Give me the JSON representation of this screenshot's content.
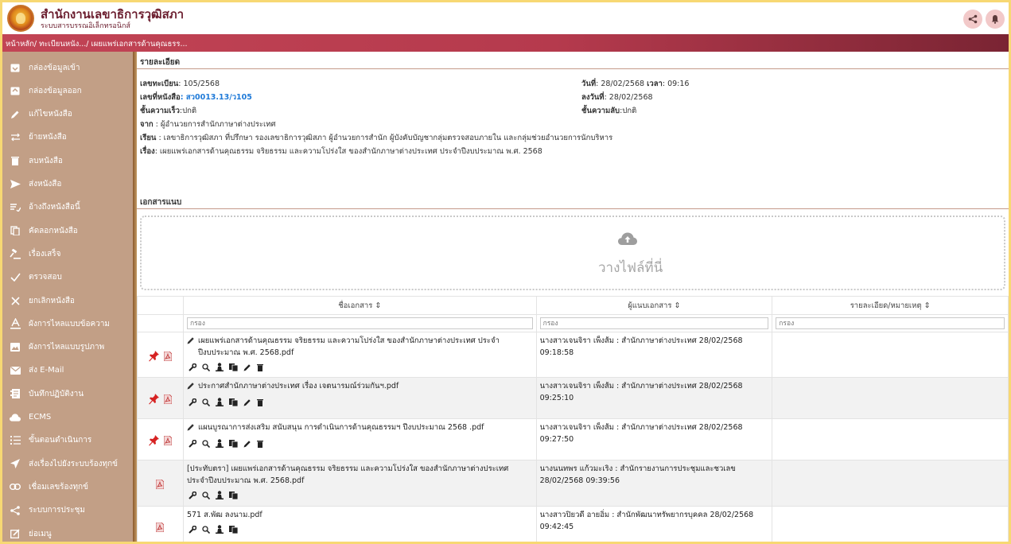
{
  "header": {
    "org_title": "สำนักงานเลขาธิการวุฒิสภา",
    "org_subtitle": "ระบบสารบรรณอิเล็กทรอนิกส์"
  },
  "breadcrumb": "หน้าหลัก/ ทะเบียนหนัง.../ เผยแพร่เอกสารด้านคุณธรร...",
  "sidebar": {
    "items": [
      {
        "label": "กล่องข้อมูลเข้า",
        "icon": "inbox-icon"
      },
      {
        "label": "กล่องข้อมูลออก",
        "icon": "outbox-icon"
      },
      {
        "label": "แก้ไขหนังสือ",
        "icon": "pencil-icon"
      },
      {
        "label": "ย้ายหนังสือ",
        "icon": "swap-icon"
      },
      {
        "label": "ลบหนังสือ",
        "icon": "trash-icon"
      },
      {
        "label": "ส่งหนังสือ",
        "icon": "send-icon"
      },
      {
        "label": "อ้างถึงหนังสือนี้",
        "icon": "reference-icon"
      },
      {
        "label": "คัดลอกหนังสือ",
        "icon": "copy-icon"
      },
      {
        "label": "เรื่องเสร็จ",
        "icon": "gavel-icon"
      },
      {
        "label": "ตรวจสอบ",
        "icon": "check-icon"
      },
      {
        "label": "ยกเลิกหนังสือ",
        "icon": "x-icon"
      },
      {
        "label": "ผังการไหลแบบข้อความ",
        "icon": "text-flow-icon"
      },
      {
        "label": "ผังการไหลแบบรูปภาพ",
        "icon": "image-flow-icon"
      },
      {
        "label": "ส่ง E-Mail",
        "icon": "mail-icon"
      },
      {
        "label": "บันทึกปฏิบัติงาน",
        "icon": "journal-icon"
      },
      {
        "label": "ECMS",
        "icon": "cloud-icon"
      },
      {
        "label": "ขั้นตอนดำเนินการ",
        "icon": "steps-icon"
      },
      {
        "label": "ส่งเรื่องไปยังระบบร้องทุกข์",
        "icon": "arrow-send-icon"
      },
      {
        "label": "เชื่อมเลขร้องทุกข์",
        "icon": "link-icon"
      },
      {
        "label": "ระบบการประชุม",
        "icon": "meeting-share-icon"
      },
      {
        "label": "ย่อเมนู",
        "icon": "collapse-icon"
      }
    ]
  },
  "details": {
    "section_title": "รายละเอียด",
    "reg_no_label": "เลขทะเบียน",
    "reg_no": ": 105/2568",
    "doc_no_label": "เลขที่หนังสือ",
    "doc_no": ": สว0013.13/ว105",
    "urgency_label": "ชั้นความเร็ว",
    "urgency": ":ปกติ",
    "from_label": "จาก",
    "from": " : ผู้อำนวยการสำนักภาษาต่างประเทศ",
    "to_label": "เรียน",
    "to": " : เลขาธิการวุฒิสภา ที่ปรึกษา รองเลขาธิการวุฒิสภา ผู้อำนวยการสำนัก ผู้บังคับบัญชากลุ่มตรวจสอบภายใน และกลุ่มช่วยอำนวยการนักบริหาร",
    "subject_label": "เรื่อง",
    "subject": ": เผยแพร่เอกสารด้านคุณธรรม จริยธรรม และความโปร่งใส ของสำนักภาษาต่างประเทศ ประจำปีงบประมาณ พ.ศ. 2568",
    "date_label": "วันที่",
    "date": ": 28/02/2568",
    "time_label": "เวลา",
    "time": ": 09:16",
    "sign_date_label": "ลงวันที่",
    "sign_date": ": 28/02/2568",
    "secrecy_label": "ชั้นความลับ",
    "secrecy": ":ปกติ"
  },
  "attachments": {
    "section_title": "เอกสารแนบ",
    "dropzone_text": "วางไฟล์ที่นี่",
    "columns": [
      "ชื่อเอกสาร ⇕",
      "ผู้แนบเอกสาร ⇕",
      "รายละเอียด/หมายเหตุ ⇕"
    ],
    "filter_placeholder": "กรอง",
    "rows": [
      {
        "name": "เผยแพร่เอกสารด้านคุณธรรม จริยธรรม และความโปร่งใส ของสำนักภาษาต่างประเทศ ประจำปีงบประมาณ พ.ศ. 2568.pdf",
        "uploader": "นางสาวเจนจิรา เพ็งส้ม : สำนักภาษาต่างประเทศ 28/02/2568 09:18:58",
        "pinned": true,
        "editable": true
      },
      {
        "name": "ประกาศสำนักภาษาต่างประเทศ เรื่อง เจตนารมณ์ร่วมกันฯ.pdf",
        "uploader": "นางสาวเจนจิรา เพ็งส้ม : สำนักภาษาต่างประเทศ 28/02/2568 09:25:10",
        "pinned": true,
        "editable": true
      },
      {
        "name": "แผนบูรณาการส่งเสริม สนับสนุน การดำเนินการด้านคุณธรรมฯ ปีงบประมาณ 2568 .pdf",
        "uploader": "นางสาวเจนจิรา เพ็งส้ม : สำนักภาษาต่างประเทศ 28/02/2568 09:27:50",
        "pinned": true,
        "editable": true
      },
      {
        "name": "[ประทับตรา] เผยแพร่เอกสารด้านคุณธรรม จริยธรรม และความโปร่งใส ของสำนักภาษาต่างประเทศ ประจำปีงบประมาณ พ.ศ. 2568.pdf",
        "uploader": "นางนนทพร แก้วมะเริง : สำนักรายงานการประชุมและชวเลข 28/02/2568 09:39:56",
        "pinned": false,
        "editable": false
      },
      {
        "name": "571 ส.พัฒ ลงนาม.pdf",
        "uploader": "นางสาวปิยวดี อายอิ่ม : สำนักพัฒนาทรัพยากรบุคคล 28/02/2568 09:42:45",
        "pinned": false,
        "editable": false
      }
    ]
  },
  "colors": {
    "accent": "#c24455",
    "sidebar": "#c29f86",
    "frame": "#f7d873",
    "link": "#1f7ad8"
  }
}
